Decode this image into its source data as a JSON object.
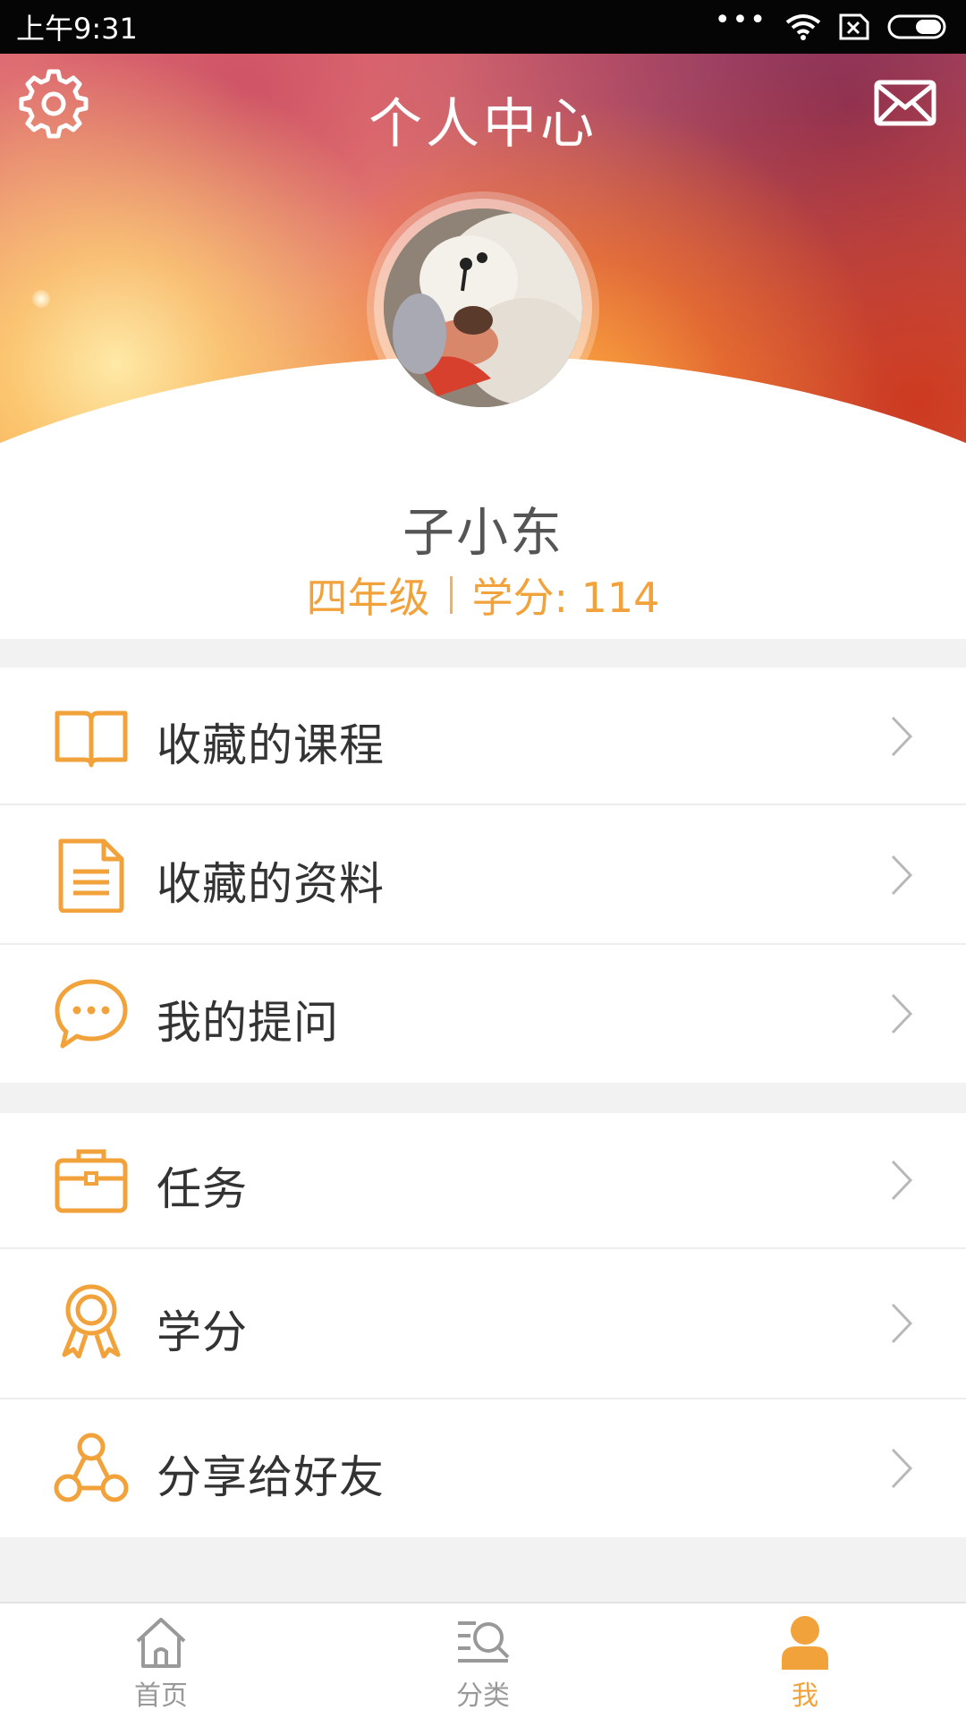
{
  "status_bar": {
    "time": "上午9:31",
    "dots": "•••"
  },
  "header": {
    "title": "个人中心"
  },
  "profile": {
    "name": "子小东",
    "grade": "四年级",
    "credits": "学分: 114"
  },
  "menu_group_1": [
    {
      "label": "收藏的课程",
      "icon": "book-icon"
    },
    {
      "label": "收藏的资料",
      "icon": "document-icon"
    },
    {
      "label": "我的提问",
      "icon": "chat-bubble-icon"
    }
  ],
  "menu_group_2": [
    {
      "label": "任务",
      "icon": "briefcase-icon"
    },
    {
      "label": "学分",
      "icon": "medal-icon"
    },
    {
      "label": "分享给好友",
      "icon": "share-icon"
    }
  ],
  "bottom_nav": [
    {
      "label": "首页",
      "icon": "home-icon",
      "active": false
    },
    {
      "label": "分类",
      "icon": "category-search-icon",
      "active": false
    },
    {
      "label": "我",
      "icon": "user-icon",
      "active": true
    }
  ],
  "colors": {
    "accent": "#f2a23b",
    "text": "#333333",
    "muted": "#999999"
  }
}
